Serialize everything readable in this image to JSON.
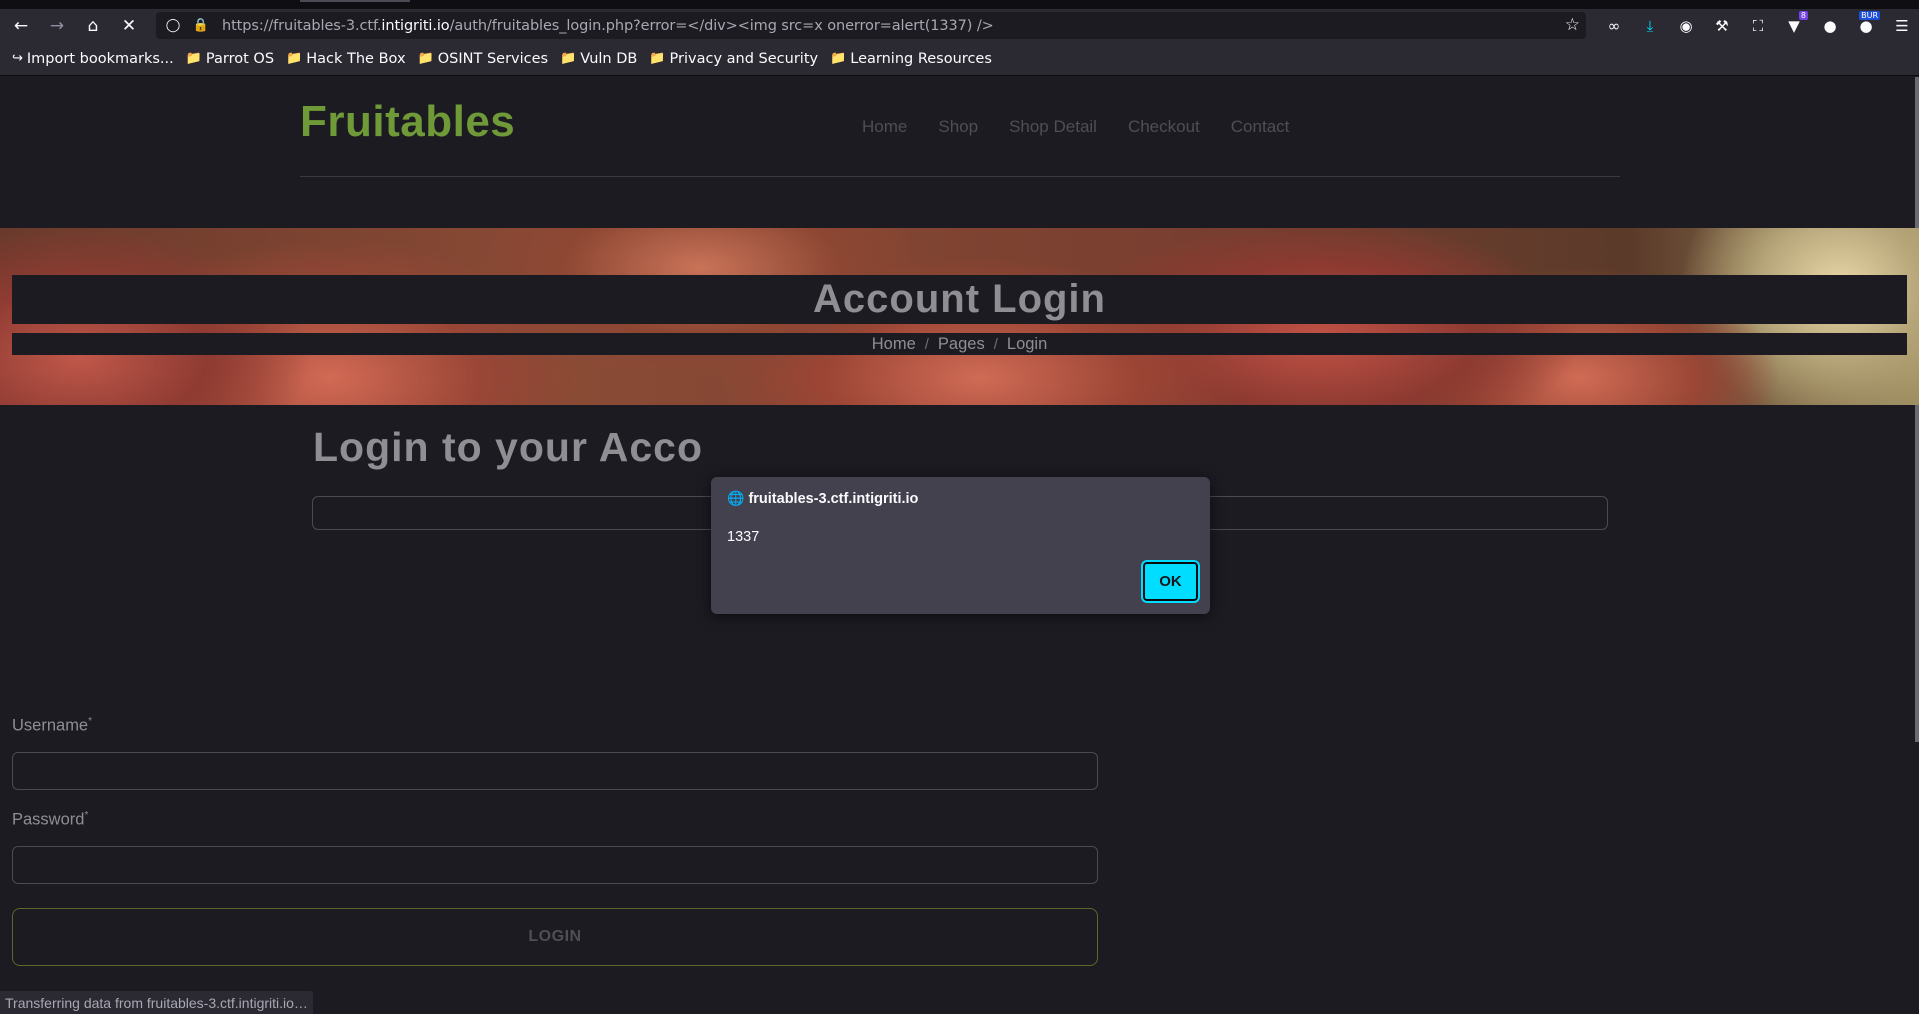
{
  "browser": {
    "url_prefix": "https://fruitables-3.ctf.",
    "url_host": "intigriti.io",
    "url_path": "/auth/fruitables_login.php?error=</div><img src=x onerror=alert(1337) />",
    "icons": [
      "back-icon",
      "forward-icon",
      "home-icon",
      "stop-icon",
      "shield-icon",
      "lock-icon",
      "star-icon"
    ],
    "extensions": [
      "infinity-icon",
      "download-icon",
      "account-icon",
      "wrench-icon",
      "puzzle-icon",
      "ublock-icon",
      "spy-icon",
      "burp-icon",
      "menu-icon"
    ],
    "ext_badge_count": "8",
    "ext_badge_burp": "BUR",
    "accent_color": "#00ddff"
  },
  "bookmarks": [
    {
      "label": "Import bookmarks...",
      "icon": "import-icon"
    },
    {
      "label": "Parrot OS",
      "icon": "folder-icon"
    },
    {
      "label": "Hack The Box",
      "icon": "folder-icon"
    },
    {
      "label": "OSINT Services",
      "icon": "folder-icon"
    },
    {
      "label": "Vuln DB",
      "icon": "folder-icon"
    },
    {
      "label": "Privacy and Security",
      "icon": "folder-icon"
    },
    {
      "label": "Learning Resources",
      "icon": "folder-icon"
    }
  ],
  "site": {
    "brand": "Fruitables",
    "brand_color": "#6f9a37",
    "nav": [
      "Home",
      "Shop",
      "Shop Detail",
      "Checkout",
      "Contact"
    ]
  },
  "hero": {
    "title": "Account Login",
    "breadcrumb": [
      "Home",
      "Pages",
      "Login"
    ],
    "breadcrumb_sep": "/"
  },
  "login": {
    "heading": "Login to your Acco",
    "username_label": "Username",
    "password_label": "Password",
    "required_mark": "*",
    "submit_label": "LOGIN"
  },
  "dialog": {
    "origin": "fruitables-3.ctf.intigriti.io",
    "message": "1337",
    "ok_label": "OK"
  },
  "status": {
    "text": "Transferring data from fruitables-3.ctf.intigriti.io…"
  }
}
